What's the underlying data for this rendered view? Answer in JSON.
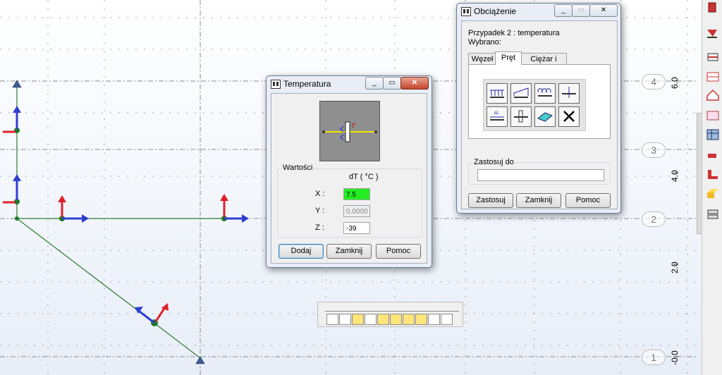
{
  "viewport": {
    "ruler_labels": [
      "6.0",
      "4.0",
      "2.0",
      "-0.0"
    ],
    "grid_markers": [
      "4",
      "3",
      "2",
      "1"
    ]
  },
  "temp_dialog": {
    "title": "Temperatura",
    "group_label": "Wartości",
    "column_header": "dT  ( °C )",
    "rows": [
      {
        "label": "X :",
        "value": "7.5"
      },
      {
        "label": "Y :",
        "value": "0,0000"
      },
      {
        "label": "Z :",
        "value": "-39"
      }
    ],
    "buttons": {
      "add": "Dodaj",
      "close": "Zamknij",
      "help": "Pomoc"
    },
    "preview_label": "t°"
  },
  "load_dialog": {
    "title": "Obciążenie",
    "case_text": "Przypadek 2 : temperatura",
    "selected_text": "Wybrano:",
    "tabs": [
      "Węzeł",
      "Pręt",
      "Ciężar i masa"
    ],
    "active_tab": "Pręt",
    "apply_to_label": "Zastosuj do",
    "apply_to_value": "",
    "buttons": {
      "apply": "Zastosuj",
      "close": "Zamknij",
      "help": "Pomoc"
    },
    "icon_buttons": [
      "uniform-load-icon",
      "trapezoidal-load-icon",
      "moment-load-icon",
      "point-force-icon",
      "dilatation-load-icon",
      "temperature-load-icon",
      "surface-load-icon",
      "delete-load-icon"
    ]
  },
  "colors": {
    "accent_x": "#2e3fcf",
    "accent_z": "#e0202a",
    "member": "#2f7a2f",
    "field_highlight": "#22ee22"
  }
}
